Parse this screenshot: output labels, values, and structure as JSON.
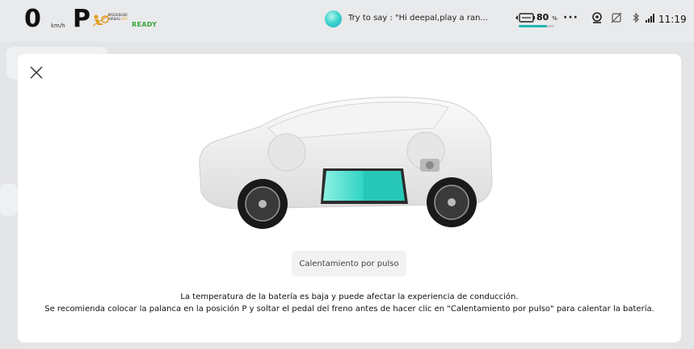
{
  "status_bar": {
    "speed": "0",
    "speed_unit": "km/h",
    "gear": "P",
    "airbag_line1": "PASSENGER",
    "airbag_line2": "AIRBAG",
    "airbag_state": "OFF",
    "ready": "READY",
    "voice_hint": "Try to say : \"Hi deepal,play a ran...",
    "battery_percent": "80",
    "battery_unit": "%",
    "battery_level": 0.8,
    "more": "···",
    "time": "11:19",
    "icons": [
      "airbag-off-icon",
      "voice-assistant-icon",
      "battery-icon",
      "more-icon",
      "camera-icon",
      "phone-off-icon",
      "bluetooth-icon",
      "signal-icon"
    ]
  },
  "dialog": {
    "close_icon": "close-icon",
    "illustration": "car-battery-illustration",
    "button_label": "Calentamiento por pulso",
    "message_line1": "La temperatura de la batería es baja y puede afectar la experiencia de conducción.",
    "message_line2": "Se recomienda colocar la palanca en la posición P y soltar el pedal del freno antes de hacer clic en \"Calentamiento por pulso\" para calentar la batería."
  },
  "colors": {
    "battery_cyan": "#2fd4c4",
    "ready_green": "#3aa63a",
    "airbag_orange": "#e39c1e",
    "accent_teal": "#21b7b0"
  }
}
